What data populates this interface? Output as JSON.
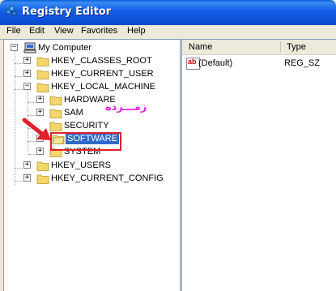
{
  "window": {
    "title": "Registry Editor"
  },
  "menu": [
    "File",
    "Edit",
    "View",
    "Favorites",
    "Help"
  ],
  "tree": {
    "root": "My Computer",
    "hives": [
      "HKEY_CLASSES_ROOT",
      "HKEY_CURRENT_USER",
      "HKEY_LOCAL_MACHINE",
      "HKEY_USERS",
      "HKEY_CURRENT_CONFIG"
    ],
    "hklm_children": [
      "HARDWARE",
      "SAM",
      "SECURITY",
      "SOFTWARE",
      "SYSTEM"
    ],
    "selected": "SOFTWARE"
  },
  "annotation_text": "زمـــرده",
  "list": {
    "columns": [
      "Name",
      "Type"
    ],
    "rows": [
      {
        "icon": "ab",
        "name": "(Default)",
        "type": "REG_SZ"
      }
    ]
  },
  "colors": {
    "title_bar": "#0a52d9",
    "selection": "#316ac5",
    "highlight_box": "#e0202a",
    "annotation": "#e024e0",
    "folder": "#f4d66a"
  }
}
